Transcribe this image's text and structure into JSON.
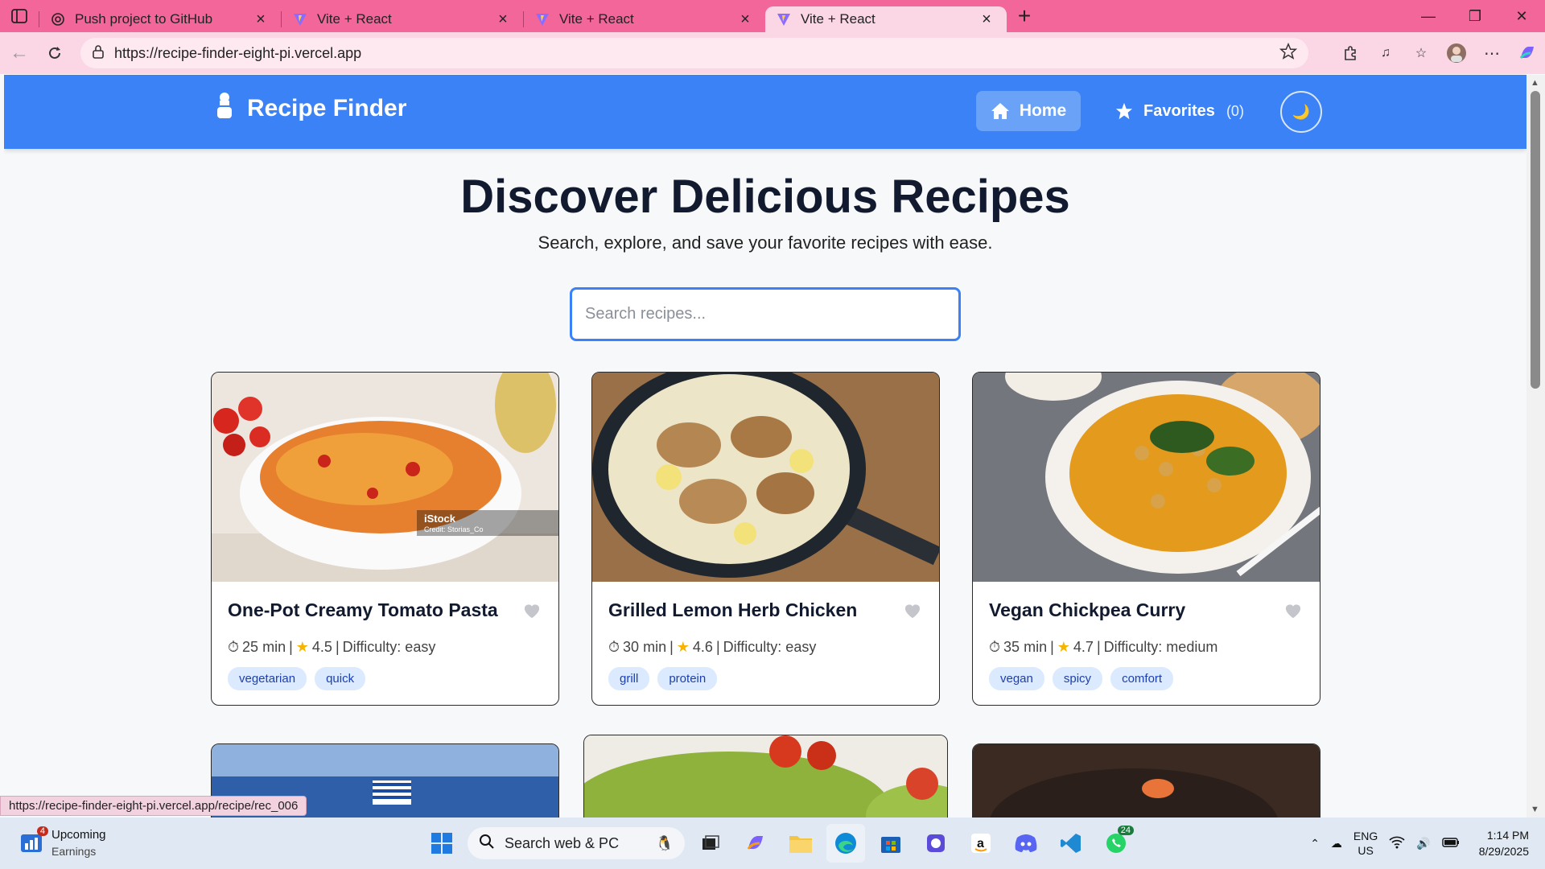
{
  "browser": {
    "tabs": [
      {
        "title": "Push project to GitHub",
        "icon": "openai-icon"
      },
      {
        "title": "Vite + React",
        "icon": "vite-icon"
      },
      {
        "title": "Vite + React",
        "icon": "vite-icon"
      },
      {
        "title": "Vite + React",
        "icon": "vite-icon",
        "active": true
      }
    ],
    "url": "https://recipe-finder-eight-pi.vercel.app",
    "status_url": "https://recipe-finder-eight-pi.vercel.app/recipe/rec_006",
    "accent": "#f2669a"
  },
  "app": {
    "brand": "Recipe Finder",
    "nav": {
      "home": "Home",
      "favorites": "Favorites",
      "favorites_count": "(0)"
    },
    "theme_toggle_icon": "moon-icon",
    "brand_color": "#3b82f6",
    "hero": {
      "title": "Discover Delicious Recipes",
      "subtitle": "Search, explore, and save your favorite recipes with ease."
    },
    "search": {
      "placeholder": "Search recipes...",
      "value": ""
    },
    "recipes": [
      {
        "title": "One-Pot Creamy Tomato Pasta",
        "time": "25 min",
        "rating": "4.5",
        "difficulty": "Difficulty: easy",
        "tags": [
          "vegetarian",
          "quick"
        ],
        "image_watermark": "iStock",
        "image_credit": "Credit: Storias_Co"
      },
      {
        "title": "Grilled Lemon Herb Chicken",
        "time": "30 min",
        "rating": "4.6",
        "difficulty": "Difficulty: easy",
        "tags": [
          "grill",
          "protein"
        ]
      },
      {
        "title": "Vegan Chickpea Curry",
        "time": "35 min",
        "rating": "4.7",
        "difficulty": "Difficulty: medium",
        "tags": [
          "vegan",
          "spicy",
          "comfort"
        ]
      }
    ]
  },
  "taskbar": {
    "widget_badge": "4",
    "widget_title": "Upcoming",
    "widget_sub": "Earnings",
    "search_label": "Search web & PC",
    "whatsapp_badge": "24",
    "lang_top": "ENG",
    "lang_bottom": "US",
    "time": "1:14 PM",
    "date": "8/29/2025"
  }
}
